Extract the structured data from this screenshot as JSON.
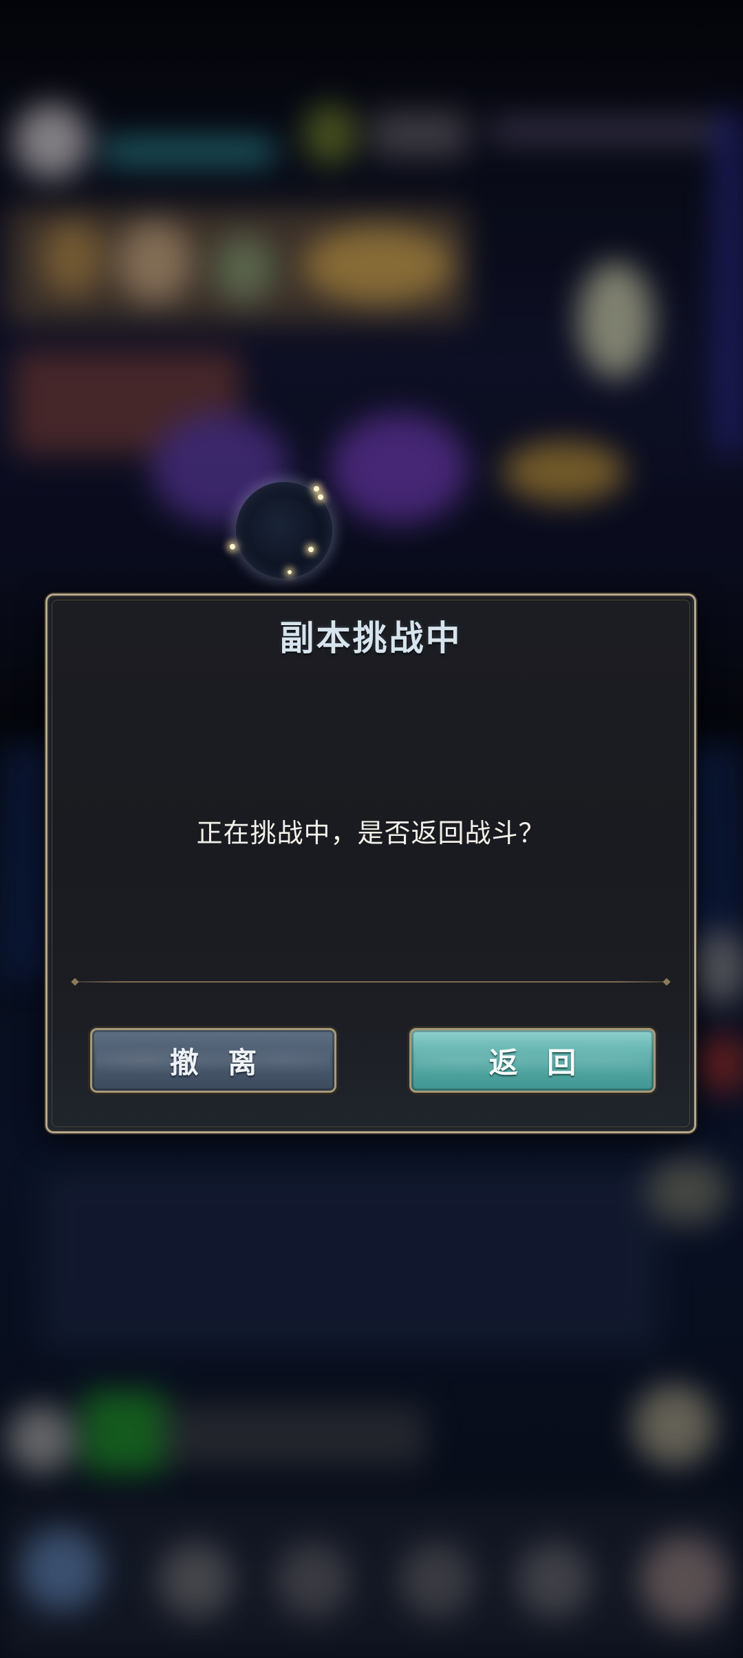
{
  "dialog": {
    "title": "副本挑战中",
    "message": "正在挑战中，是否返回战斗？",
    "buttons": {
      "leave_label": "撤 离",
      "return_label": "返 回"
    }
  },
  "colors": {
    "frame_gold": "#b9a987",
    "leave_button": "#4b5b6f",
    "return_button": "#5fb1ad",
    "title_text": "#d7e4ee"
  },
  "icons": {
    "loading": "loading-orb-icon"
  }
}
